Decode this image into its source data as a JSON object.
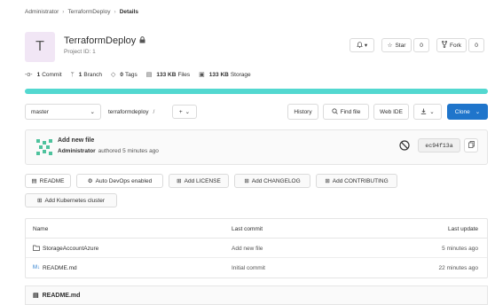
{
  "breadcrumb": {
    "item1": "Administrator",
    "item2": "TerraformDeploy",
    "item3": "Details"
  },
  "project": {
    "avatar_letter": "T",
    "name": "TerraformDeploy",
    "id": "Project ID: 1"
  },
  "header_actions": {
    "notify": "▾",
    "star": "Star",
    "star_count": "0",
    "fork": "Fork",
    "fork_count": "0"
  },
  "stats": {
    "commits_n": "1",
    "commits_l": "Commit",
    "branches_n": "1",
    "branches_l": "Branch",
    "tags_n": "0",
    "tags_l": "Tags",
    "files_n": "133 KB",
    "files_l": "Files",
    "storage_n": "133 KB",
    "storage_l": "Storage"
  },
  "toolbar": {
    "branch": "master",
    "path": "terraformdeploy",
    "path_sep": "/",
    "add": "+",
    "history": "History",
    "find_file": "Find file",
    "web_ide": "Web IDE",
    "clone": "Clone"
  },
  "commit": {
    "title": "Add new file",
    "author": "Administrator",
    "meta": "authored 5 minutes ago",
    "sha": "ec94f13a"
  },
  "quick_actions": [
    "README",
    "Auto DevOps enabled",
    "Add LICENSE",
    "Add CHANGELOG",
    "Add CONTRIBUTING",
    "Add Kubernetes cluster"
  ],
  "table": {
    "headers": {
      "name": "Name",
      "commit": "Last commit",
      "update": "Last update"
    },
    "rows": [
      {
        "name": "StorageAccountAzure",
        "commit": "Add new file",
        "update": "5 minutes ago"
      },
      {
        "name": "README.md",
        "commit": "Initial commit",
        "update": "22 minutes ago"
      }
    ]
  },
  "readme_header": "README.md",
  "colors": {
    "accent": "#1f75cb",
    "progress": "#53d8d0"
  }
}
